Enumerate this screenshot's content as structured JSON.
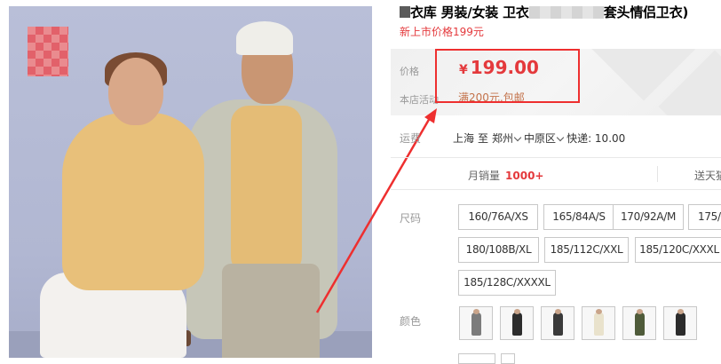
{
  "title": {
    "part1": "衣库 男装/女装 卫衣",
    "part2": "套头情侣卫衣)"
  },
  "subtitle": "新上市价格199元",
  "price": {
    "label": "价格",
    "currency": "¥",
    "value": "199.00",
    "promo_label": "本店活动",
    "promo_text": "满200元,包邮"
  },
  "shipping": {
    "label": "运费",
    "from": "上海",
    "to_word": "至",
    "city": "郑州",
    "district": "中原区",
    "express": "快递: 10.00"
  },
  "stats": {
    "sales_label": "月销量",
    "sales_value": "1000+",
    "gift_text": "送天猫"
  },
  "sku": {
    "size_label": "尺码",
    "sizes": [
      "160/76A/XS",
      "165/84A/S",
      "170/92A/M",
      "175/",
      "180/108B/XL",
      "185/112C/XXL",
      "185/120C/XXXL",
      "185/128C/XXXXL"
    ],
    "color_label": "颜色",
    "colors": [
      "#7c7c7c",
      "#2d2d2d",
      "#3a3a3a",
      "#e9e2cc",
      "#4f5b3a",
      "#2b2b2b",
      "#1e1e22"
    ]
  },
  "accent": {
    "price_red": "#e4393c",
    "highlight_border": "#ee2f2f",
    "promo_brown": "#c3724a"
  }
}
